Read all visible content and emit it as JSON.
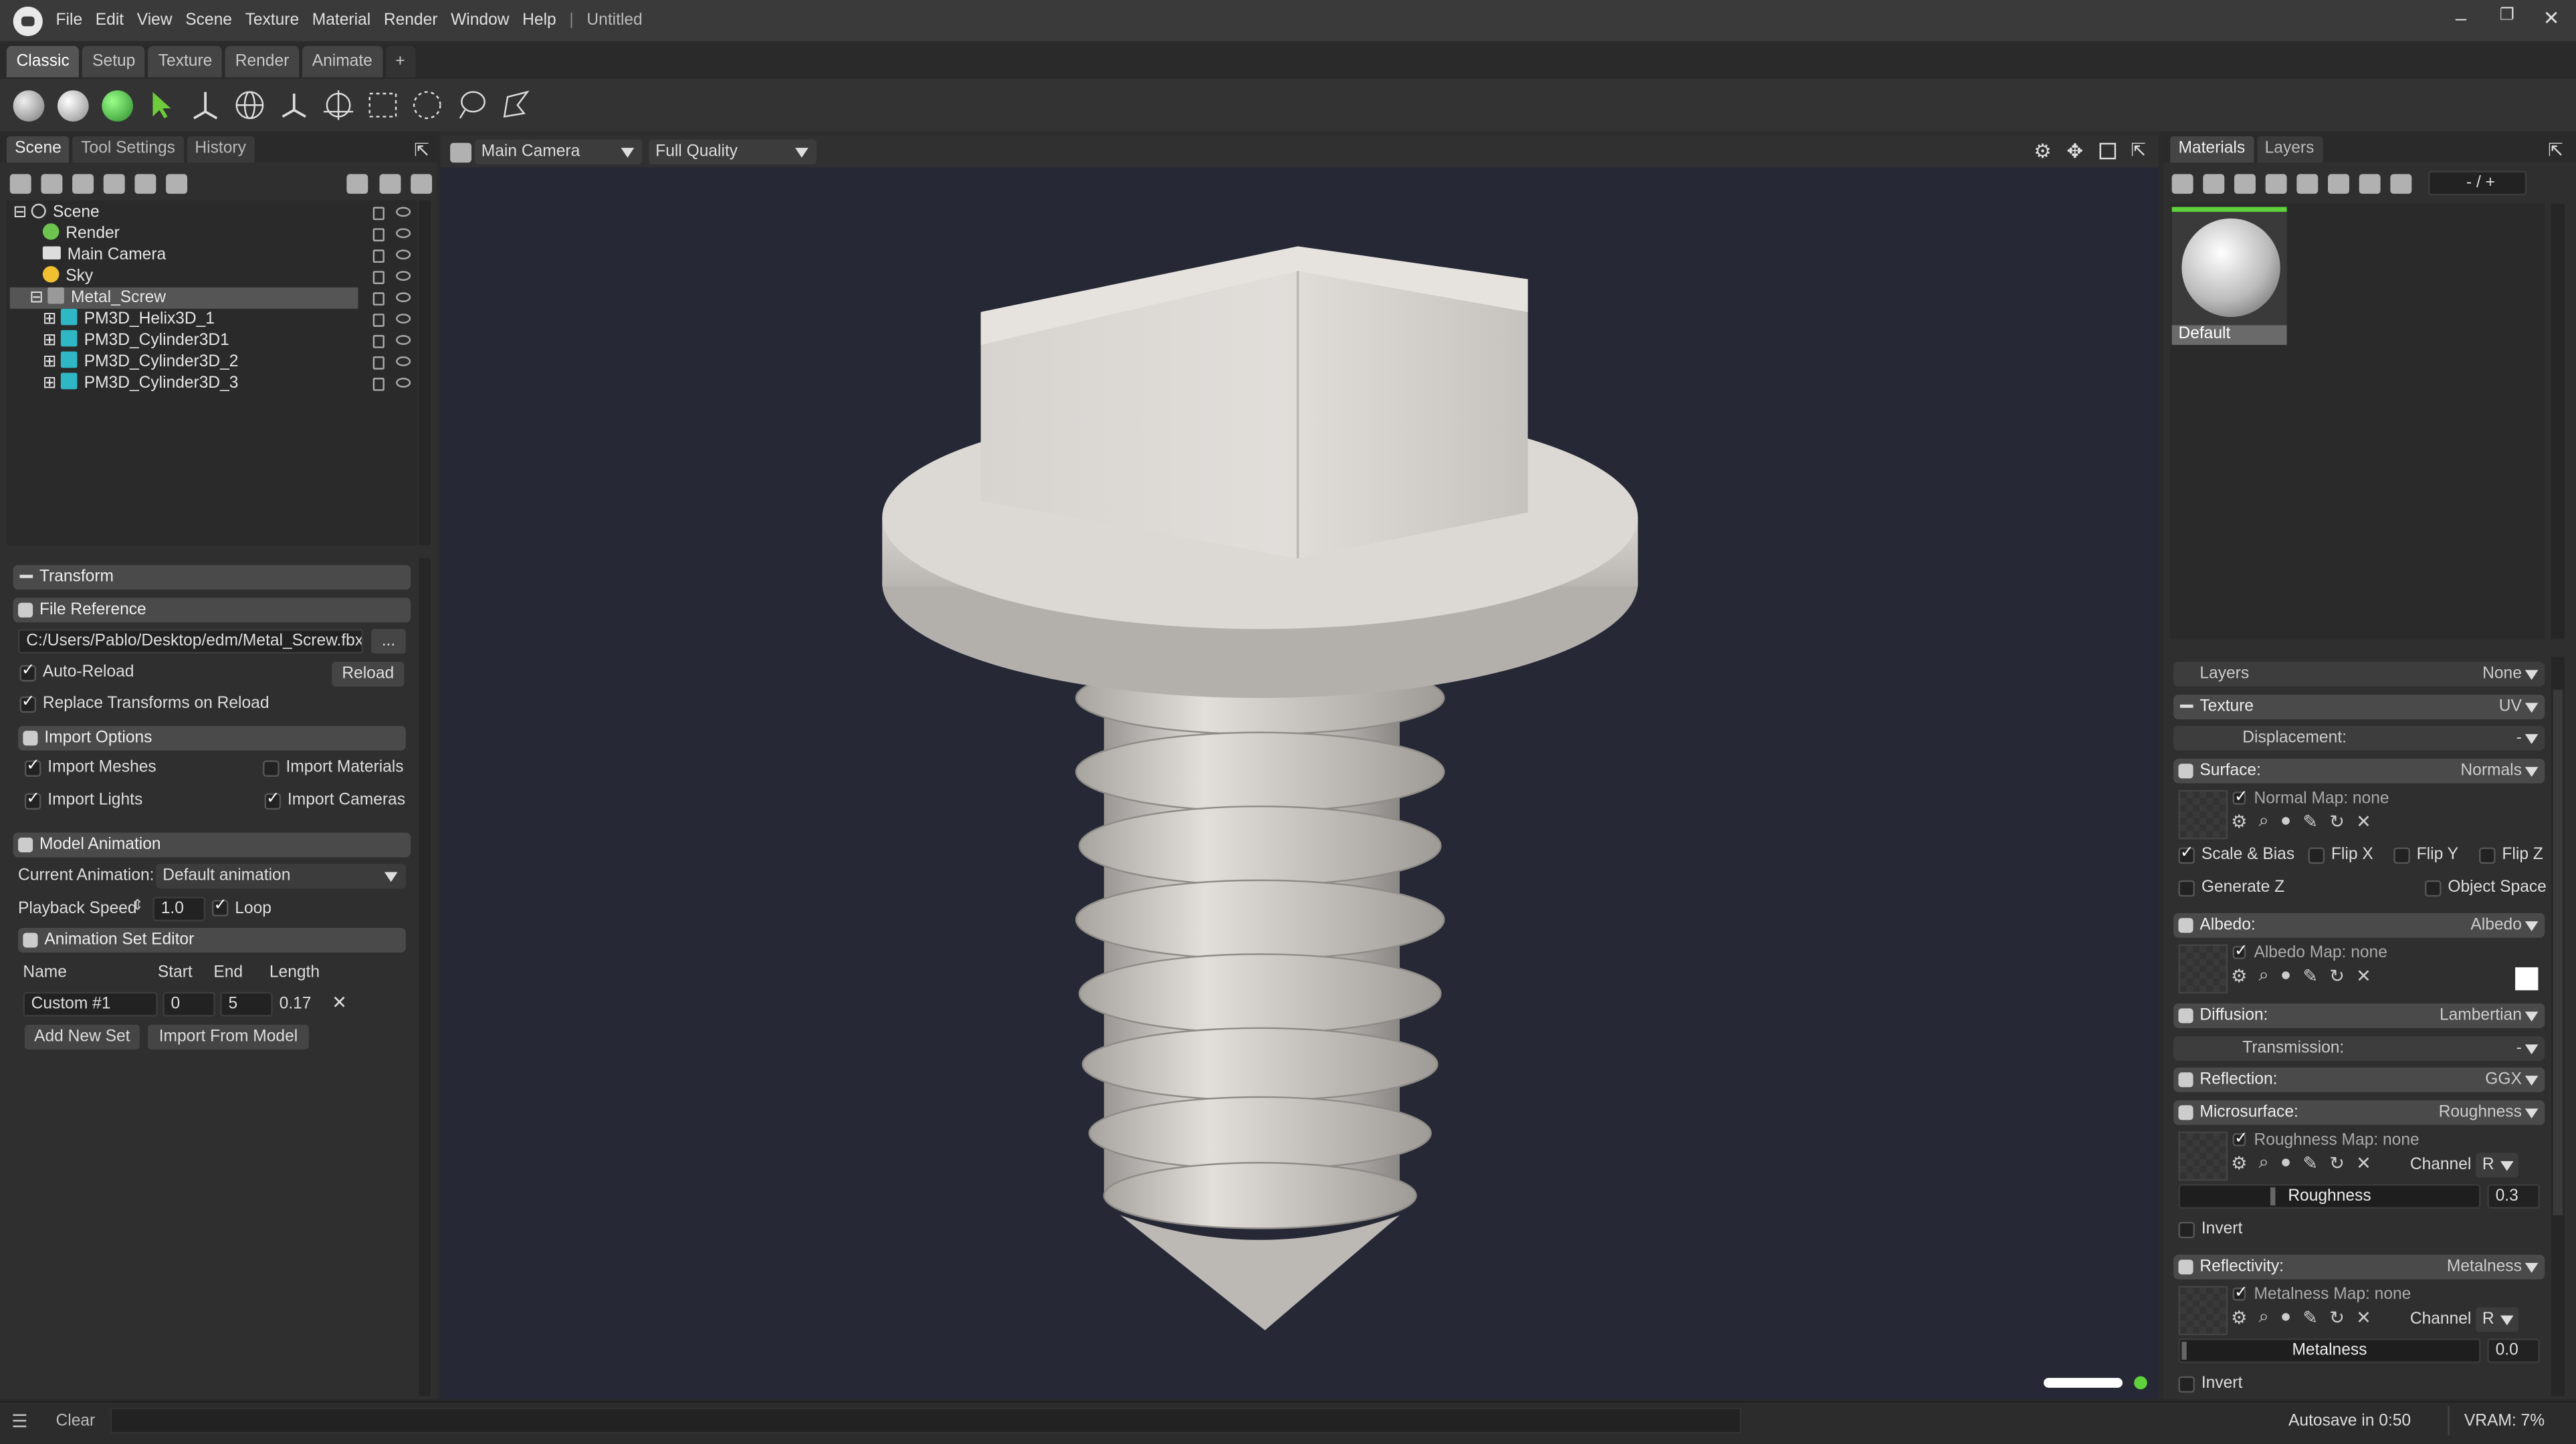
{
  "title_bar": {
    "menus": [
      "File",
      "Edit",
      "View",
      "Scene",
      "Texture",
      "Material",
      "Render",
      "Window",
      "Help"
    ],
    "separator": "|",
    "doc_title": "Untitled"
  },
  "workspace_tabs": [
    "Classic",
    "Setup",
    "Texture",
    "Render",
    "Animate",
    "+"
  ],
  "left_panel": {
    "tabs": [
      "Scene",
      "Tool Settings",
      "History"
    ],
    "tree": [
      "Scene",
      "Render",
      "Main Camera",
      "Sky",
      "Metal_Screw",
      "PM3D_Helix3D_1",
      "PM3D_Cylinder3D1",
      "PM3D_Cylinder3D_2",
      "PM3D_Cylinder3D_3"
    ],
    "transform": "Transform",
    "file_reference": {
      "title": "File Reference",
      "path": "C:/Users/Pablo/Desktop/edm/Metal_Screw.fbx",
      "browse": "...",
      "auto_reload": "Auto-Reload",
      "reload": "Reload",
      "replace": "Replace Transforms on Reload"
    },
    "import_options": {
      "title": "Import Options",
      "meshes": "Import Meshes",
      "materials": "Import Materials",
      "lights": "Import Lights",
      "cameras": "Import Cameras"
    },
    "model_animation": {
      "title": "Model Animation",
      "current_label": "Current Animation:",
      "current_value": "Default animation",
      "speed_label": "Playback Speed",
      "speed_value": "1.0",
      "loop": "Loop"
    },
    "anim_set_editor": {
      "title": "Animation Set Editor",
      "col_name": "Name",
      "col_start": "Start",
      "col_end": "End",
      "col_length": "Length",
      "row_name": "Custom #1",
      "row_start": "0",
      "row_end": "5",
      "row_length": "0.17",
      "remove": "✕",
      "add_set": "Add New Set",
      "import_model": "Import From Model"
    }
  },
  "viewport": {
    "camera": "Main Camera",
    "quality": "Full Quality"
  },
  "right_panel": {
    "tabs": [
      "Materials",
      "Layers"
    ],
    "counter": "- / +",
    "material_name": "Default",
    "layers": {
      "label": "Layers",
      "value": "None"
    },
    "texture": {
      "label": "Texture",
      "value": "UV"
    },
    "displacement": {
      "label": "Displacement:",
      "value": "-"
    },
    "surface": {
      "label": "Surface:",
      "value": "Normals",
      "map": "Normal Map: none",
      "scale_bias": "Scale & Bias",
      "flip_x": "Flip X",
      "flip_y": "Flip Y",
      "flip_z": "Flip Z",
      "generate_z": "Generate Z",
      "object_space": "Object Space"
    },
    "albedo": {
      "label": "Albedo:",
      "value": "Albedo",
      "map": "Albedo Map: none"
    },
    "diffusion": {
      "label": "Diffusion:",
      "value": "Lambertian"
    },
    "transmission": {
      "label": "Transmission:",
      "value": "-"
    },
    "reflection": {
      "label": "Reflection:",
      "value": "GGX"
    },
    "microsurface": {
      "label": "Microsurface:",
      "value": "Roughness",
      "map": "Roughness Map: none",
      "channel": "Channel",
      "channel_value": "R",
      "slider_label": "Roughness",
      "slider_value": "0.3",
      "invert": "Invert"
    },
    "reflectivity": {
      "label": "Reflectivity:",
      "value": "Metalness",
      "map": "Metalness Map: none",
      "channel": "Channel",
      "channel_value": "R",
      "slider_label": "Metalness",
      "slider_value": "0.0",
      "invert": "Invert"
    }
  },
  "status": {
    "clear": "Clear",
    "autosave": "Autosave in 0:50",
    "vram": "VRAM: 7%"
  }
}
